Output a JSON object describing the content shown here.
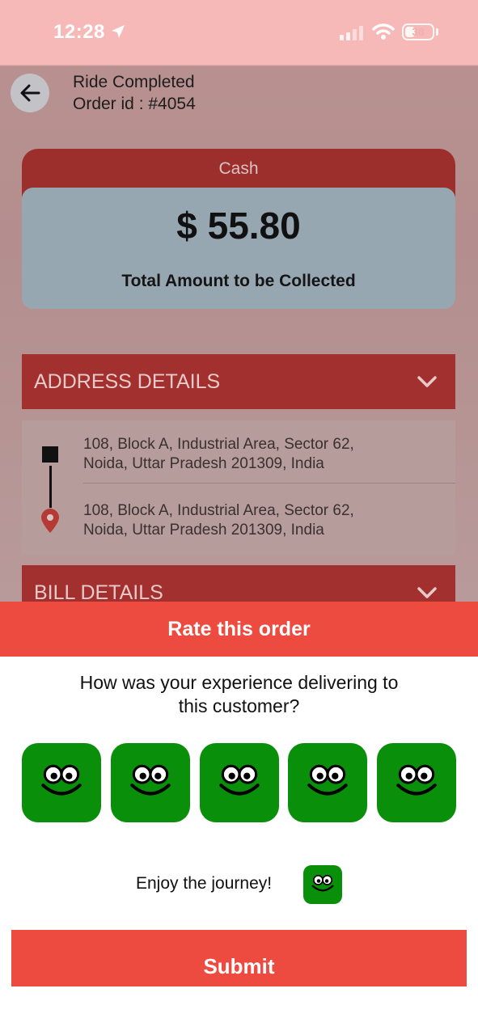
{
  "status_bar": {
    "time": "12:28",
    "battery": "38",
    "battery_level": 0.38
  },
  "header": {
    "title": "Ride Completed",
    "order_id": "Order id : #4054"
  },
  "payment": {
    "method": "Cash",
    "amount": "$ 55.80",
    "caption": "Total Amount to be Collected"
  },
  "address_section": {
    "title": "ADDRESS DETAILS",
    "pickup_line1": "108, Block A, Industrial Area, Sector 62,",
    "pickup_line2": "Noida, Uttar Pradesh 201309, India",
    "drop_line1": "108, Block A, Industrial Area, Sector 62,",
    "drop_line2": "Noida, Uttar Pradesh 201309, India"
  },
  "bill_section": {
    "title": "BILL DETAILS"
  },
  "rating": {
    "header": "Rate this order",
    "question_line1": "How was your experience delivering to",
    "question_line2": "this customer?",
    "options_count": 5,
    "selected_text": "Enjoy the journey!",
    "submit_label": "Submit"
  },
  "colors": {
    "accent": "#ee4b40",
    "face": "#0a8f0a",
    "dark_red": "#a2302e"
  }
}
